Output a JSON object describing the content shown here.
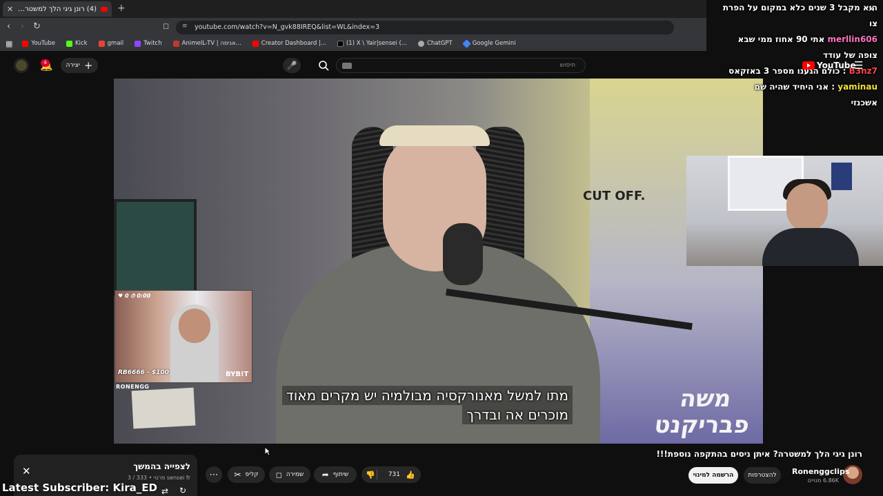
{
  "browser": {
    "tab_title": "(4) רונן גיגי הלך למשטרה? איתן",
    "tab_close": "✕",
    "new_tab": "+",
    "url": "youtube.com/watch?v=N_gvk88IREQ&list=WL&index=3",
    "bookmarks": [
      {
        "label": "YouTube",
        "color": "#ff0000"
      },
      {
        "label": "Kick",
        "color": "#53fc18"
      },
      {
        "label": "gmail",
        "color": "#ea4335"
      },
      {
        "label": "Twitch",
        "color": "#9146ff"
      },
      {
        "label": "AnimeIL-TV | אנימה...",
        "color": "#c0392b"
      },
      {
        "label": "Creator Dashboard |...",
        "color": "#ff0000"
      },
      {
        "label": "(1) X \\ Yair|sensei (...",
        "color": "#000000"
      },
      {
        "label": "ChatGPT",
        "color": "#aaaaaa"
      },
      {
        "label": "Google Gemini",
        "color": "#4285f4"
      }
    ]
  },
  "youtube": {
    "create_label": "יצירה",
    "notification_count": "4",
    "search_placeholder": "חיפוש",
    "logo_text": "YouTube"
  },
  "video": {
    "subtitle_line1": "מתו למשל מאנורקסיה מבולמיה יש מקרים מאוד",
    "subtitle_line2": "מוכרים אה ובדרך",
    "nameplate_line1": "משה",
    "nameplate_line2": "פבריקנט"
  },
  "overlay": {
    "webcam_counter": "0",
    "webcam_timer": "0:00",
    "donation": "RB6666 - $100",
    "brand": "BYB!T",
    "ronen_label": "RONENGG",
    "latest_subscriber": "Latest Subscriber: Kira_ED",
    "chat_close": "✕",
    "chat": [
      {
        "user": "",
        "msg": "הוא מקבל 3 שנים כלא במקום על הפרת צו",
        "color": "#ffffff"
      },
      {
        "user": "merllin606",
        "msg": "אתי 90 אחוז ממי שבא",
        "color": "#ff72c1"
      },
      {
        "user": "",
        "msg": "צופה של עודד",
        "color": "#ffffff"
      },
      {
        "user": "B3nz7",
        "msg": "כולם הגענו מספר 3 באזקאס",
        "color": "#ff4545"
      },
      {
        "user": "yaminau",
        "msg": "אני היחיד שהיה שם",
        "color": "#f3e13a"
      },
      {
        "user": "",
        "msg": "אשכנזי",
        "color": "#ffffff"
      }
    ]
  },
  "video_info": {
    "title": "רונן גיגי הלך למשטרה? איתן ניסים בהתקפה נוספת!!!",
    "channel_name": "Ronenggclips",
    "channel_subs": "6.86K מנויים",
    "join_label": "להצטרפות",
    "subscribe_label": "הרשמה למינוי",
    "likes": "731",
    "share_label": "שיתוף",
    "save_label": "שמירה",
    "clip_label": "קליפ"
  },
  "playlist": {
    "title": "לצפייה בהמשך",
    "meta": "sensei fr פרטי • 333 / 3"
  }
}
